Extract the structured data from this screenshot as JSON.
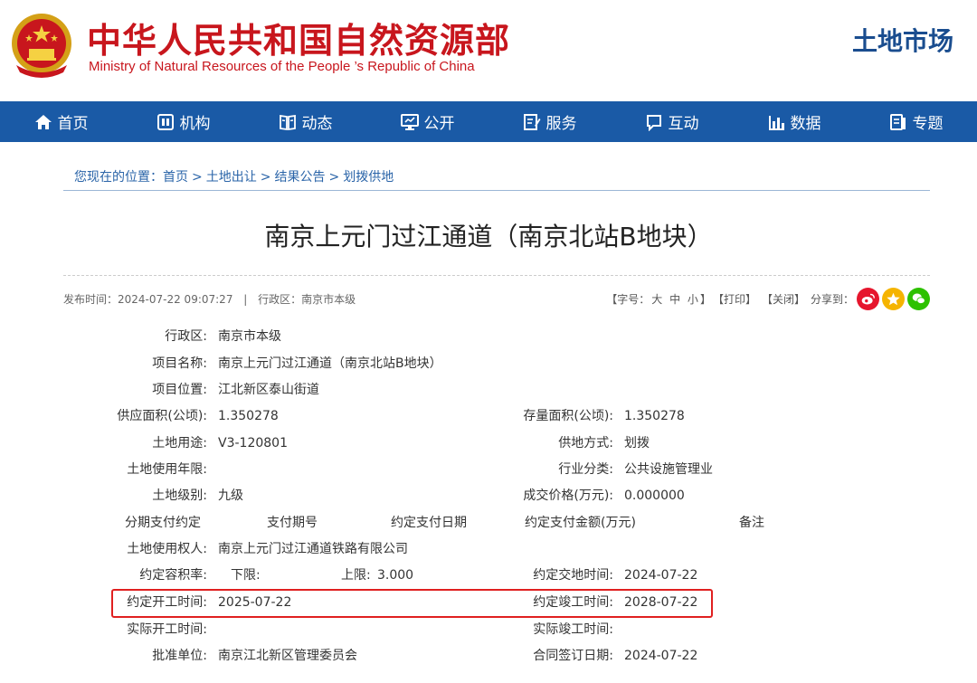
{
  "header": {
    "title_cn": "中华人民共和国自然资源部",
    "title_en": "Ministry of Natural Resources of the People ’s Republic of China",
    "market": "土地市场",
    "emblem_icon": "national-emblem-icon"
  },
  "nav": {
    "items": [
      {
        "label": "首页",
        "icon": "home-icon"
      },
      {
        "label": "机构",
        "icon": "institution-icon"
      },
      {
        "label": "动态",
        "icon": "book-icon"
      },
      {
        "label": "公开",
        "icon": "monitor-icon"
      },
      {
        "label": "服务",
        "icon": "edit-doc-icon"
      },
      {
        "label": "互动",
        "icon": "chat-icon"
      },
      {
        "label": "数据",
        "icon": "bar-chart-icon"
      },
      {
        "label": "专题",
        "icon": "topic-icon"
      }
    ]
  },
  "breadcrumb": {
    "prefix": "您现在的位置：",
    "items": [
      "首页",
      "土地出让",
      "结果公告",
      "划拨供地"
    ],
    "sep": ">"
  },
  "article": {
    "title": "南京上元门过江通道（南京北站B地块）",
    "publish_label": "发布时间：2024-07-22 09:07:27",
    "divider": "|",
    "district_meta": "行政区：南京市本级"
  },
  "tools": {
    "font_label": "【字号：",
    "font_large": "大",
    "font_medium": "中",
    "font_small": "小",
    "font_close": "】",
    "print": "【打印】",
    "close": "【关闭】",
    "share_label": "分享到："
  },
  "details": {
    "district_label": "行政区:",
    "district_value": "南京市本级",
    "project_name_label": "项目名称:",
    "project_name_value": "南京上元门过江通道（南京北站B地块）",
    "location_label": "项目位置:",
    "location_value": "江北新区泰山街道",
    "supply_area_label": "供应面积(公顷):",
    "supply_area_value": "1.350278",
    "stock_area_label": "存量面积(公顷):",
    "stock_area_value": "1.350278",
    "land_use_label": "土地用途:",
    "land_use_value": "V3-120801",
    "supply_method_label": "供地方式:",
    "supply_method_value": "划拨",
    "use_years_label": "土地使用年限:",
    "use_years_value": "",
    "industry_label": "行业分类:",
    "industry_value": "公共设施管理业",
    "land_grade_label": "土地级别:",
    "land_grade_value": "九级",
    "price_label": "成交价格(万元):",
    "price_value": "0.000000",
    "installment_header": "分期支付约定",
    "period_header": "支付期号",
    "pay_date_header": "约定支付日期",
    "pay_amount_header": "约定支付金额(万元)",
    "remark_header": "备注",
    "user_label": "土地使用权人:",
    "user_value": "南京上元门过江通道铁路有限公司",
    "far_label": "约定容积率:",
    "far_lower_label": "下限:",
    "far_lower_value": "",
    "far_upper_label": "上限:",
    "far_upper_value": "3.000",
    "delivery_label": "约定交地时间:",
    "delivery_value": "2024-07-22",
    "start_label": "约定开工时间:",
    "start_value": "2025-07-22",
    "complete_label": "约定竣工时间:",
    "complete_value": "2028-07-22",
    "actual_start_label": "实际开工时间:",
    "actual_start_value": "",
    "actual_complete_label": "实际竣工时间:",
    "actual_complete_value": "",
    "approver_label": "批准单位:",
    "approver_value": "南京江北新区管理委员会",
    "contract_date_label": "合同签订日期:",
    "contract_date_value": "2024-07-22"
  },
  "colors": {
    "brand_red": "#c8161d",
    "nav_blue": "#1a5aa6",
    "highlight_red": "#e02020"
  }
}
